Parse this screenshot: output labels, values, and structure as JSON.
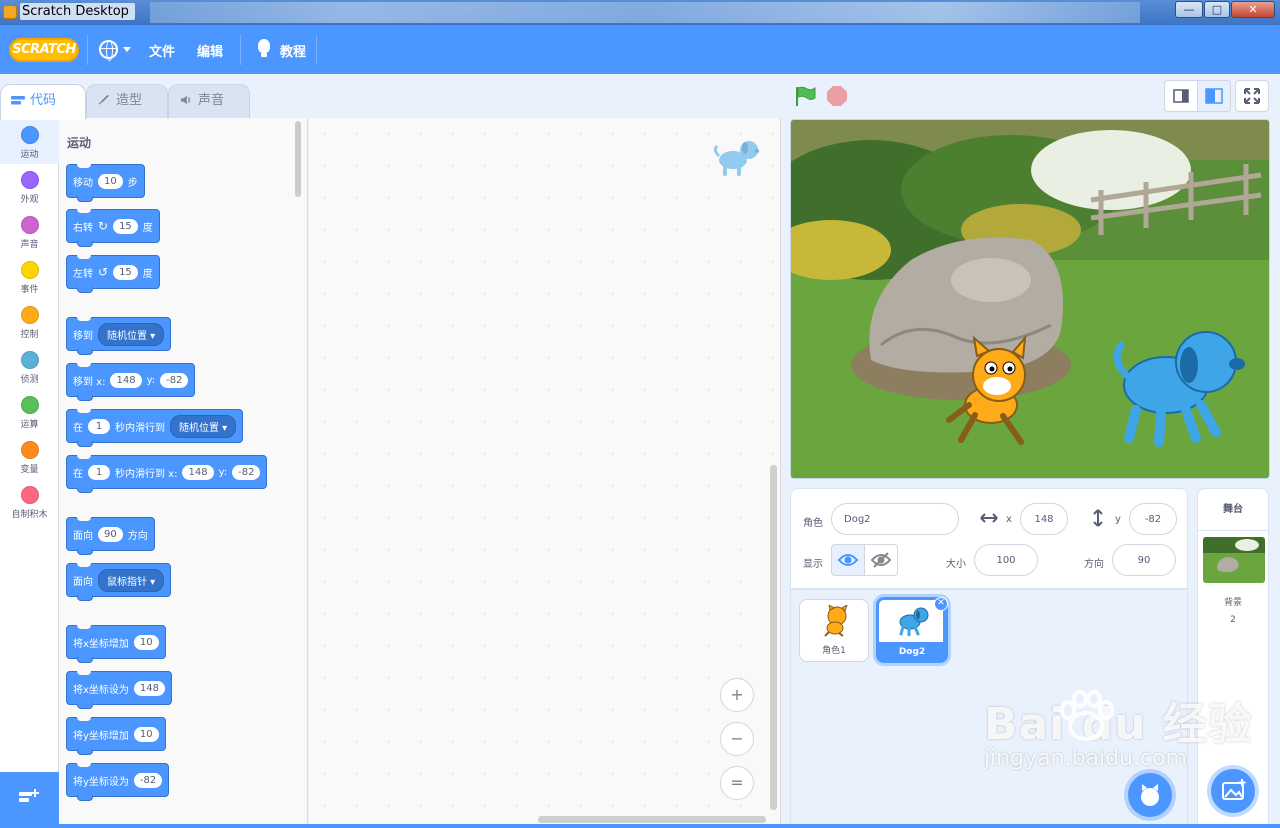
{
  "window": {
    "title": "Scratch Desktop",
    "min_glyph": "—",
    "max_glyph": "□",
    "close_glyph": "✕"
  },
  "menubar": {
    "logo_text": "SCRATCH",
    "file": "文件",
    "edit": "编辑",
    "tutorials": "教程"
  },
  "tabs": [
    {
      "label": "代码",
      "active": true
    },
    {
      "label": "造型",
      "active": false
    },
    {
      "label": "声音",
      "active": false
    }
  ],
  "categories": [
    {
      "label": "运动",
      "color": "#4c97ff"
    },
    {
      "label": "外观",
      "color": "#9966ff"
    },
    {
      "label": "声音",
      "color": "#cf63cf"
    },
    {
      "label": "事件",
      "color": "#ffd500"
    },
    {
      "label": "控制",
      "color": "#ffab19"
    },
    {
      "label": "侦测",
      "color": "#5cb1d6"
    },
    {
      "label": "运算",
      "color": "#59c059"
    },
    {
      "label": "变量",
      "color": "#ff8c1a"
    },
    {
      "label": "自制积木",
      "color": "#ff6680"
    }
  ],
  "palette": {
    "section_title": "运动",
    "blocks": {
      "move": {
        "a": "移动",
        "n": "10",
        "b": "步"
      },
      "turn_right": {
        "a": "右转",
        "n": "15",
        "b": "度",
        "glyph": "↻"
      },
      "turn_left": {
        "a": "左转",
        "n": "15",
        "b": "度",
        "glyph": "↺"
      },
      "goto": {
        "a": "移到",
        "dd": "随机位置"
      },
      "goto_xy": {
        "a": "移到 x:",
        "x": "148",
        "yl": "y:",
        "y": "-82"
      },
      "glide_to": {
        "a": "在",
        "n": "1",
        "b": "秒内滑行到",
        "dd": "随机位置"
      },
      "glide_xy": {
        "a": "在",
        "n": "1",
        "b": "秒内滑行到 x:",
        "x": "148",
        "yl": "y:",
        "y": "-82"
      },
      "point_dir": {
        "a": "面向",
        "n": "90",
        "b": "方向"
      },
      "point_towards": {
        "a": "面向",
        "dd": "鼠标指针"
      },
      "change_x": {
        "a": "将x坐标增加",
        "n": "10"
      },
      "set_x": {
        "a": "将x坐标设为",
        "n": "148"
      },
      "change_y": {
        "a": "将y坐标增加",
        "n": "10"
      },
      "set_y": {
        "a": "将y坐标设为",
        "n": "-82"
      }
    }
  },
  "zoom": {
    "in": "+",
    "out": "−",
    "reset": "="
  },
  "sprite_info": {
    "sprite_label": "角色",
    "sprite_name": "Dog2",
    "x_label": "x",
    "x": "148",
    "y_label": "y",
    "y": "-82",
    "show_label": "显示",
    "size_label": "大小",
    "size": "100",
    "direction_label": "方向",
    "direction": "90"
  },
  "sprites": [
    {
      "name": "角色1",
      "selected": false
    },
    {
      "name": "Dog2",
      "selected": true
    }
  ],
  "stage_panel": {
    "header": "舞台",
    "backdrops_label": "背景",
    "backdrops_count": "2"
  },
  "watermark": {
    "brand": "Bai  du 经验",
    "url": "jingyan.baidu.com"
  },
  "colors": {
    "accent": "#4c97ff",
    "motion": "#4c97ff",
    "stop": "#ec5959",
    "flag": "#4cbf56"
  }
}
